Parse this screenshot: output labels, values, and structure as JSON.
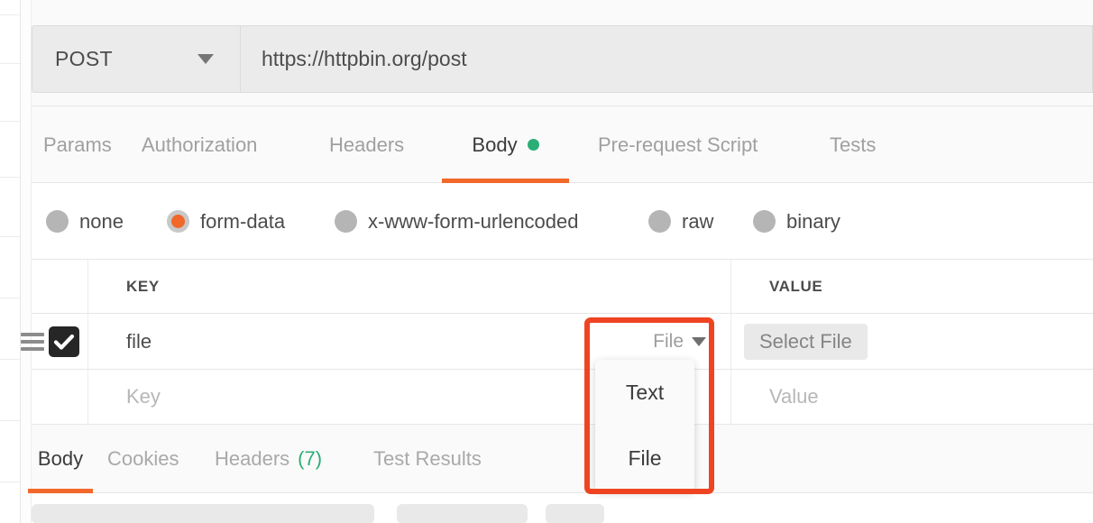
{
  "request": {
    "method": "POST",
    "url": "https://httpbin.org/post",
    "tabs": [
      {
        "label": "Params",
        "active": false,
        "dot": false
      },
      {
        "label": "Authorization",
        "active": false,
        "dot": false
      },
      {
        "label": "Headers",
        "active": false,
        "dot": false
      },
      {
        "label": "Body",
        "active": true,
        "dot": true
      },
      {
        "label": "Pre-request Script",
        "active": false,
        "dot": false
      },
      {
        "label": "Tests",
        "active": false,
        "dot": false
      }
    ],
    "body_modes": [
      {
        "label": "none",
        "selected": false
      },
      {
        "label": "form-data",
        "selected": true
      },
      {
        "label": "x-www-form-urlencoded",
        "selected": false
      },
      {
        "label": "raw",
        "selected": false
      },
      {
        "label": "binary",
        "selected": false
      }
    ]
  },
  "table": {
    "headers": {
      "key": "KEY",
      "value": "VALUE"
    },
    "rows": [
      {
        "checked": true,
        "key": "file",
        "key_is_placeholder": false,
        "type": "File",
        "value_button": "Select File",
        "value_placeholder": ""
      },
      {
        "checked": false,
        "key": "Key",
        "key_is_placeholder": true,
        "type": "",
        "value_button": "",
        "value_placeholder": "Value"
      }
    ]
  },
  "type_menu": {
    "options": [
      "Text",
      "File"
    ]
  },
  "response": {
    "tabs": [
      {
        "label": "Body",
        "active": true,
        "count": ""
      },
      {
        "label": "Cookies",
        "active": false,
        "count": ""
      },
      {
        "label": "Headers",
        "active": false,
        "count": "(7)"
      },
      {
        "label": "Test Results",
        "active": false,
        "count": ""
      }
    ]
  },
  "colors": {
    "accent_orange": "#f2682a",
    "highlight_red": "#ef4422",
    "status_green": "#2aae76"
  }
}
